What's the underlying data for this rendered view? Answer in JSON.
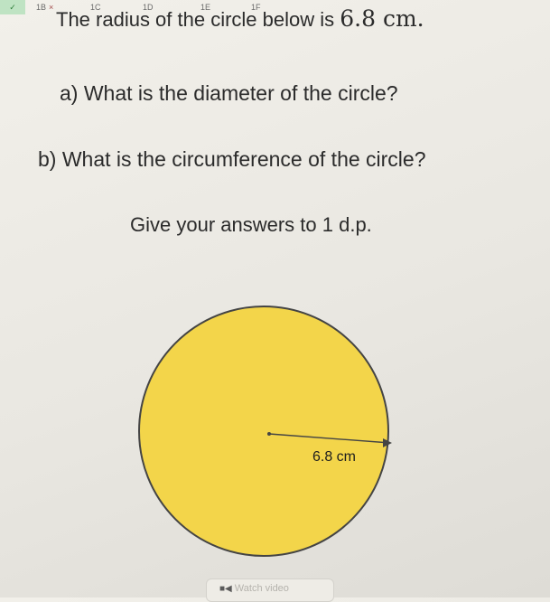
{
  "tabs": [
    {
      "label": "✓"
    },
    {
      "label": "1B",
      "mark": "×"
    },
    {
      "label": "1C"
    },
    {
      "label": "1D"
    },
    {
      "label": "1E"
    },
    {
      "label": "1F"
    }
  ],
  "question": {
    "intro": "The radius of the circle below is",
    "radius_value": "6.8 cm.",
    "part_a": "a) What is the diameter of the circle?",
    "part_b": "b) What is the circumference of the circle?",
    "instruction": "Give your answers to 1 d.p."
  },
  "diagram": {
    "label": "6.8 cm",
    "fill_color": "#f3d54a",
    "stroke_color": "#444444"
  },
  "watch_button": {
    "label": "Watch video",
    "icon": "video-icon"
  }
}
